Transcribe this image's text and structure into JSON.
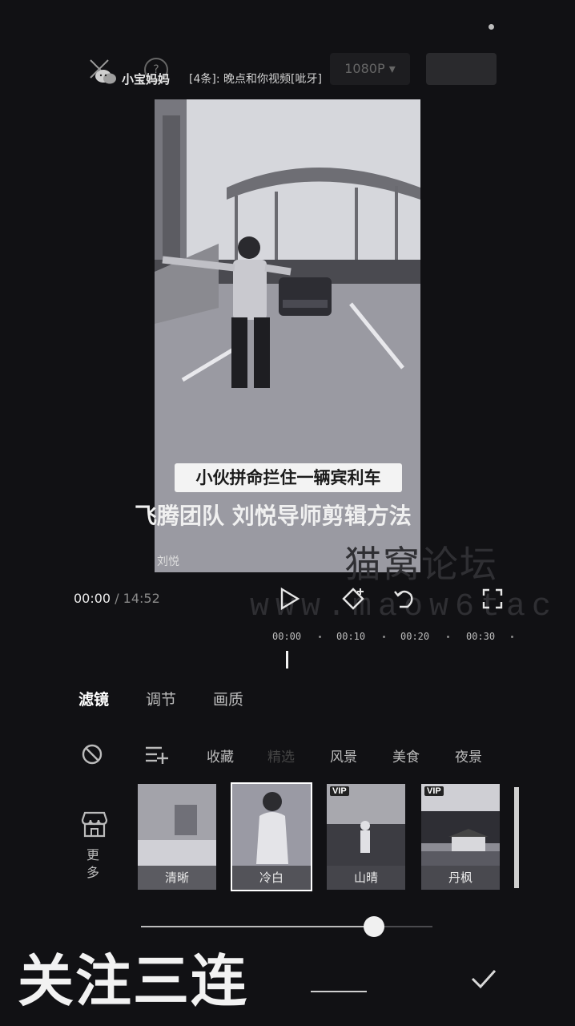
{
  "notification": {
    "user": "小宝妈妈",
    "message": "[4条]: 晚点和你视频[呲牙]",
    "help_glyph": "?"
  },
  "toolbar": {
    "resolution": "1080P ▾"
  },
  "video": {
    "caption": "小伙拼命拦住一辆宾利车",
    "overlay_text": "飞腾团队 刘悦导师剪辑方法",
    "brand": "刘悦"
  },
  "watermark": {
    "line1": "猫窝论坛",
    "line2": "www.maow6tac"
  },
  "player": {
    "current_time": "00:00",
    "separator": " / ",
    "total_time": "14:52"
  },
  "timeline": {
    "ticks": [
      "00:00",
      "00:10",
      "00:20",
      "00:30"
    ]
  },
  "tabs": [
    {
      "label": "滤镜",
      "active": true
    },
    {
      "label": "调节",
      "active": false
    },
    {
      "label": "画质",
      "active": false
    }
  ],
  "categories": [
    "收藏",
    "精选",
    "风景",
    "美食",
    "夜景"
  ],
  "more_label": "更多",
  "filters": [
    {
      "label": "清晰",
      "vip": false,
      "selected": false
    },
    {
      "label": "冷白",
      "vip": false,
      "selected": true
    },
    {
      "label": "山晴",
      "vip": true,
      "selected": false
    },
    {
      "label": "丹枫",
      "vip": true,
      "selected": false
    }
  ],
  "vip_badge": "VIP",
  "intensity": 0.8,
  "overlay_promo": "关注三连",
  "icons": [
    "close-icon",
    "help-icon",
    "wechat-icon",
    "play-icon",
    "keyframe-icon",
    "undo-icon",
    "fullscreen-icon",
    "no-filter-icon",
    "filter-list-icon",
    "store-icon",
    "check-icon"
  ]
}
